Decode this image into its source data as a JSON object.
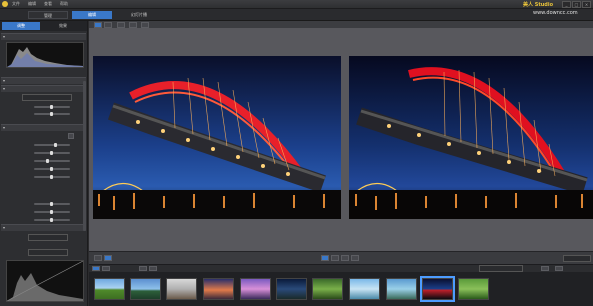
{
  "app": {
    "brand": "美人 Studio",
    "url": "www.downcc.com",
    "window_buttons": [
      "_",
      "□",
      "×"
    ]
  },
  "top_menu": [
    "文件",
    "编辑",
    "查看",
    "帮助"
  ],
  "modes": [
    {
      "label": "管理",
      "active": false
    },
    {
      "label": "编辑",
      "active": true
    },
    {
      "label": "幻灯片播",
      "active": false
    }
  ],
  "left_tabs": [
    {
      "label": "调整",
      "active": true
    },
    {
      "label": "效果",
      "active": false
    }
  ],
  "histogram": {
    "title": "",
    "axis_labels": [
      "",
      "",
      ""
    ]
  },
  "sections": [
    {
      "title": ""
    },
    {
      "title": ""
    },
    {
      "title": ""
    },
    {
      "title": ""
    },
    {
      "title": ""
    }
  ],
  "sliders": {
    "group1": [
      {
        "label": "",
        "value": "",
        "pos": 0.5
      },
      {
        "label": "",
        "value": "",
        "pos": 0.5
      }
    ],
    "group2": [
      {
        "label": "",
        "value": "",
        "pos": 0.5
      },
      {
        "label": "",
        "value": "",
        "pos": 0.5
      },
      {
        "label": "",
        "value": "",
        "pos": 0.5
      },
      {
        "label": "",
        "value": "",
        "pos": 0.5
      },
      {
        "label": "",
        "value": "",
        "pos": 0.5
      }
    ],
    "group3": [
      {
        "label": "",
        "value": "",
        "pos": 0.5
      },
      {
        "label": "",
        "value": "",
        "pos": 0.5
      },
      {
        "label": "",
        "value": "",
        "pos": 0.5
      }
    ]
  },
  "compare_labels": {
    "before": "",
    "after": ""
  },
  "bottom_dropdown": {
    "label": ""
  },
  "filmstrip_sort": "",
  "colors": {
    "accent": "#4d9cff",
    "brand": "#e8c23a",
    "bridge": "#e8202a"
  },
  "thumbnails": [
    {
      "name": "thumb-landscape-green",
      "selected": false
    },
    {
      "name": "thumb-landscape-sea",
      "selected": false
    },
    {
      "name": "thumb-trees",
      "selected": false
    },
    {
      "name": "thumb-sunset",
      "selected": false
    },
    {
      "name": "thumb-purple-lake",
      "selected": false
    },
    {
      "name": "thumb-night-mountain",
      "selected": false
    },
    {
      "name": "thumb-forest",
      "selected": false
    },
    {
      "name": "thumb-beach",
      "selected": false
    },
    {
      "name": "thumb-coast",
      "selected": false
    },
    {
      "name": "thumb-bridge-night",
      "selected": true
    },
    {
      "name": "thumb-green-field",
      "selected": false
    }
  ]
}
